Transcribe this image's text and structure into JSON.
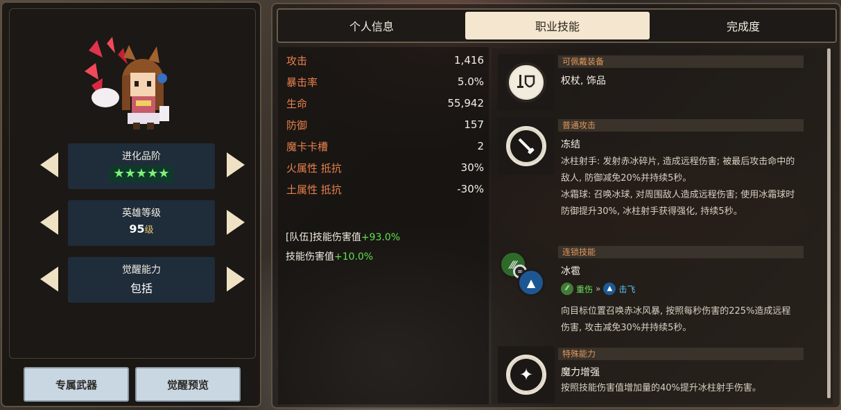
{
  "colors": {
    "accent": "#e9804c",
    "positive": "#62e24a",
    "active_tab": "#f4e6cf",
    "header_text": "#e2975c"
  },
  "left": {
    "evolution": {
      "title": "进化品阶",
      "stars": "★★★★★",
      "star_count": 5
    },
    "level": {
      "title": "英雄等级",
      "value": "95",
      "unit": "级"
    },
    "awaken": {
      "title": "觉醒能力",
      "value": "包括"
    },
    "buttons": {
      "weapon": "专属武器",
      "preview": "觉醒预览"
    }
  },
  "tabs": [
    {
      "label": "个人信息",
      "active": false
    },
    {
      "label": "职业技能",
      "active": true
    },
    {
      "label": "完成度",
      "active": false
    }
  ],
  "stats": [
    {
      "name": "攻击",
      "value": "1,416"
    },
    {
      "name": "暴击率",
      "value": "5.0%"
    },
    {
      "name": "生命",
      "value": "55,942"
    },
    {
      "name": "防御",
      "value": "157"
    },
    {
      "name": "魔卡卡槽",
      "value": "2"
    },
    {
      "name": "火属性 抵抗",
      "value": "30%"
    },
    {
      "name": "土属性 抵抗",
      "value": "-30%"
    }
  ],
  "damage": {
    "team_label": "[队伍]技能伤害值",
    "team_value": "+93.0%",
    "skill_label": "技能伤害值",
    "skill_value": "+10.0%"
  },
  "skills": {
    "equip": {
      "header": "可佩戴装备",
      "desc": "权杖, 饰品",
      "icon": "sword-shield-icon"
    },
    "normal": {
      "header": "普通攻击",
      "name": "冻结",
      "icon": "sword-icon",
      "desc1": "冰柱射手: 发射赤冰碎片, 造成远程伤害; 被最后攻击命中的敌人, 防御减免20%并持续5秒。",
      "desc2": "冰霜球: 召唤冰球, 对周围敌人造成远程伤害; 使用冰霜球时防御提升30%, 冰柱射手获得强化, 持续5秒。"
    },
    "chain": {
      "header": "连锁技能",
      "name": "冰雹",
      "icon": "claw-chain-icon",
      "tag_from": "重伤",
      "tag_sep": "»",
      "tag_to": "击飞",
      "desc": "向目标位置召唤赤冰风暴, 按照每秒伤害的225%造成远程伤害, 攻击减免30%并持续5秒。"
    },
    "special": {
      "header": "特殊能力",
      "name": "魔力增强",
      "icon": "sparkle-icon",
      "desc": "按照技能伤害值增加量的40%提升冰柱射手伤害。"
    }
  }
}
